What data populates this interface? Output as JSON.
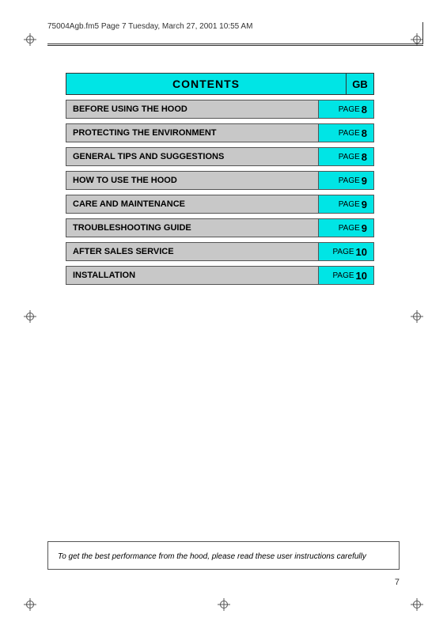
{
  "header": {
    "text": "75004Agb.fm5  Page 7  Tuesday, March 27, 2001  10:55 AM"
  },
  "contents": {
    "title": "CONTENTS",
    "gb_label": "GB",
    "rows": [
      {
        "label": "BEFORE USING THE HOOD",
        "page_word": "PAGE",
        "page_num": "8"
      },
      {
        "label": "PROTECTING THE ENVIRONMENT",
        "page_word": "PAGE",
        "page_num": "8"
      },
      {
        "label": "GENERAL TIPS AND SUGGESTIONS",
        "page_word": "PAGE",
        "page_num": "8"
      },
      {
        "label": "HOW TO USE THE HOOD",
        "page_word": "PAGE",
        "page_num": "9"
      },
      {
        "label": "CARE AND MAINTENANCE",
        "page_word": "PAGE",
        "page_num": "9"
      },
      {
        "label": "TROUBLESHOOTING GUIDE",
        "page_word": "PAGE",
        "page_num": "9"
      },
      {
        "label": "AFTER SALES SERVICE",
        "page_word": "PAGE",
        "page_num": "10"
      },
      {
        "label": "INSTALLATION",
        "page_word": "PAGE",
        "page_num": "10"
      }
    ]
  },
  "footer": {
    "note": "To get the best performance from the hood, please read these user instructions carefully",
    "page_number": "7"
  }
}
